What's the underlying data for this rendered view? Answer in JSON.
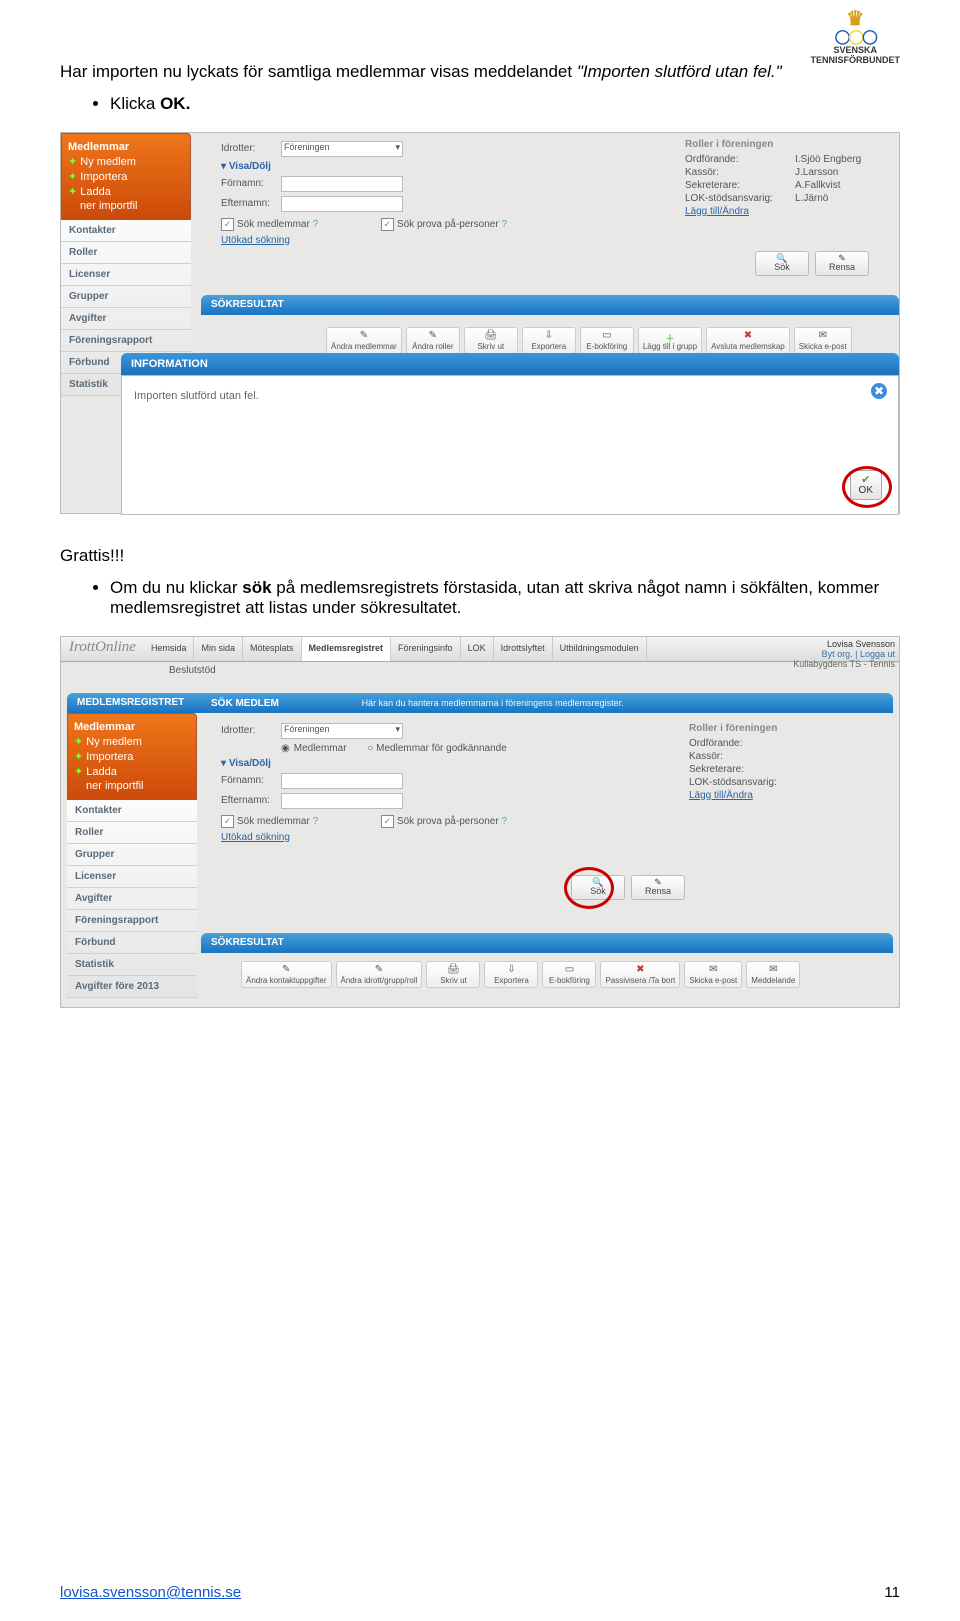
{
  "logo_text": "SVENSKA\nTENNISFÖRBUNDET",
  "intro": {
    "p1": "Har importen nu lyckats för samtliga medlemmar visas meddelandet ",
    "p1_em": "\"Importen slutförd utan fel.\"",
    "bullet1_prefix": "Klicka ",
    "bullet1_bold": "OK."
  },
  "grattis": "Grattis!!!",
  "mid": {
    "bullet_prefix": "Om du nu klickar ",
    "bullet_bold": "sök",
    "bullet_suffix": " på medlemsregistrets förstasida, utan att skriva något namn i sökfälten, kommer medlemsregistret att listas under sökresultatet."
  },
  "screenshot1": {
    "sidemenu_title": "Medlemmar",
    "side_orange": [
      "Ny medlem",
      "Importera",
      "Ladda",
      "ner importfil"
    ],
    "side_grey": [
      "Kontakter",
      "Roller",
      "Licenser",
      "Grupper",
      "Avgifter",
      "Föreningsrapport",
      "Förbund",
      "Statistik"
    ],
    "form": {
      "idrotter": "Idrotter:",
      "idrotter_val": "Föreningen",
      "visa": "Visa/Dölj",
      "fornamn": "Förnamn:",
      "efternamn": "Efternamn:",
      "sok_medlemmar": "Sök medlemmar",
      "sok_prova": "Sök prova på-personer",
      "utokad": "Utökad sökning"
    },
    "roles": {
      "title": "Roller i föreningen",
      "rows": [
        [
          "Ordförande:",
          "I.Sjöö Engberg"
        ],
        [
          "Kassör:",
          "J.Larsson"
        ],
        [
          "Sekreterare:",
          "A.Fallkvist"
        ],
        [
          "LOK-stödsansvarig:",
          "L.Järnö"
        ]
      ],
      "link": "Lägg till/Ändra"
    },
    "btns": [
      "Sök",
      "Rensa"
    ],
    "sokresultat": "SÖKRESULTAT",
    "toolbar": [
      "Ändra medlemmar",
      "Ändra roller",
      "Skriv ut",
      "Exportera",
      "E-bokföring",
      "Lägg till i grupp",
      "Avsluta medlemskap",
      "Skicka e-post"
    ],
    "info_title": "INFORMATION",
    "info_text": "Importen slutförd utan fel.",
    "ok": "OK"
  },
  "screenshot2": {
    "brand": "IrottOnline",
    "tabs": [
      "Hemsida",
      "Min sida",
      "Mötesplats",
      "Medlemsregistret",
      "Föreningsinfo",
      "LOK",
      "Idrottslyftet",
      "Utbildningsmodulen"
    ],
    "sub": "Beslutstöd",
    "user": {
      "name": "Lovisa Svensson",
      "links": "Byt org. | Logga ut",
      "org": "Kullabygdens TS - Tennis"
    },
    "hdr_left": "MEDLEMSREGISTRET",
    "hdr_mid": "SÖK MEDLEM",
    "hdr_right": "Här kan du hantera medlemmarna i föreningens medlemsregister.",
    "sidemenu_title": "Medlemmar",
    "side_orange": [
      "Ny medlem",
      "Importera",
      "Ladda",
      "ner importfil"
    ],
    "side_grey": [
      "Kontakter",
      "Roller",
      "Grupper",
      "Licenser",
      "Avgifter",
      "Föreningsrapport",
      "Förbund",
      "Statistik",
      "Avgifter före 2013"
    ],
    "form": {
      "idrotter": "Idrotter:",
      "idrotter_val": "Föreningen",
      "radio1": "Medlemmar",
      "radio2": "Medlemmar för godkännande",
      "visa": "Visa/Dölj",
      "fornamn": "Förnamn:",
      "efternamn": "Efternamn:",
      "sok_medlemmar": "Sök medlemmar",
      "sok_prova": "Sök prova på-personer",
      "utokad": "Utökad sökning"
    },
    "roles": {
      "title": "Roller i föreningen",
      "rows": [
        [
          "Ordförande:",
          ""
        ],
        [
          "Kassör:",
          ""
        ],
        [
          "Sekreterare:",
          ""
        ],
        [
          "LOK-stödsansvarig:",
          ""
        ]
      ],
      "link": "Lägg till/Ändra"
    },
    "btns": [
      "Sök",
      "Rensa"
    ],
    "sokresultat": "SÖKRESULTAT",
    "toolbar": [
      "Ändra kontaktuppgifter",
      "Ändra idrott/grupp/roll",
      "Skriv ut",
      "Exportera",
      "E-bokföring",
      "Passivisera /Ta bort",
      "Skicka e-post",
      "Meddelande"
    ]
  },
  "footer": {
    "email": "lovisa.svensson@tennis.se",
    "page": "11"
  }
}
